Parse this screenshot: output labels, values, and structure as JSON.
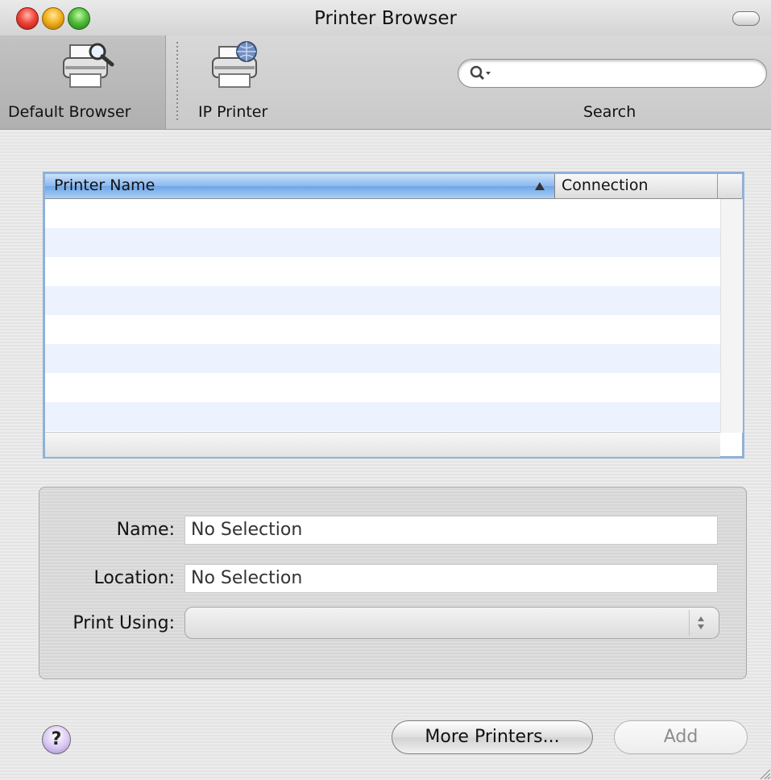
{
  "window": {
    "title": "Printer Browser"
  },
  "toolbar": {
    "default_browser_label": "Default Browser",
    "ip_printer_label": "IP Printer",
    "search_label": "Search",
    "search_placeholder": ""
  },
  "table": {
    "columns": [
      "Printer Name",
      "Connection"
    ],
    "sort_column": "Printer Name",
    "sort_direction": "ascending",
    "rows": []
  },
  "details": {
    "name_label": "Name:",
    "name_value": "No Selection",
    "location_label": "Location:",
    "location_value": "No Selection",
    "print_using_label": "Print Using:",
    "print_using_value": ""
  },
  "buttons": {
    "help": "?",
    "more_printers": "More Printers...",
    "add": "Add"
  },
  "colors": {
    "selected_header": "#8ab8ee",
    "row_stripe": "#edf3fe",
    "table_focus_border": "#8fb1d9"
  }
}
